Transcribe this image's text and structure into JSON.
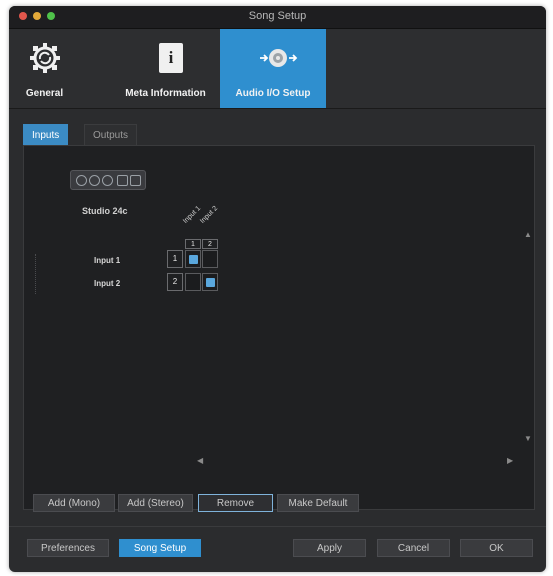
{
  "window": {
    "title": "Song Setup"
  },
  "toolbar": {
    "items": [
      {
        "label": "General",
        "icon": "gear-icon"
      },
      {
        "label": "Meta Information",
        "icon": "document-info-icon",
        "glyph": "i"
      },
      {
        "label": "Audio I/O Setup",
        "icon": "audio-io-icon"
      }
    ],
    "active_item": "Audio I/O Setup"
  },
  "tabs": [
    {
      "label": "Inputs"
    },
    {
      "label": "Outputs"
    }
  ],
  "active_tab": "Inputs",
  "matrix": {
    "device_label": "Studio 24c",
    "columns": [
      {
        "name": "Input 1",
        "num": "1"
      },
      {
        "name": "Input 2",
        "num": "2"
      }
    ],
    "rows": [
      {
        "label": "Input 1",
        "num": "1",
        "checked": [
          true,
          false
        ]
      },
      {
        "label": "Input 2",
        "num": "2",
        "checked": [
          false,
          true
        ]
      }
    ]
  },
  "actions": {
    "add_mono": "Add (Mono)",
    "add_stereo": "Add (Stereo)",
    "remove": "Remove",
    "make_default": "Make Default"
  },
  "footer": {
    "preferences": "Preferences",
    "song_setup": "Song Setup",
    "apply": "Apply",
    "cancel": "Cancel",
    "ok": "OK"
  },
  "colors": {
    "accent": "#2f8fcf",
    "background": "#2b2c2e",
    "panel": "#1f2022"
  }
}
